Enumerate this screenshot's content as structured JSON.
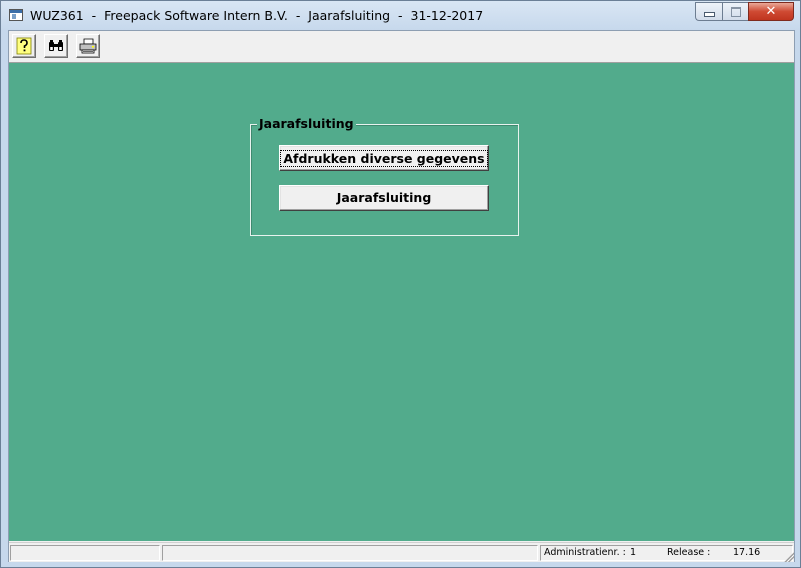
{
  "window": {
    "title": "WUZ361  -  Freepack Software Intern B.V.  -  Jaarafsluiting  -  31-12-2017",
    "icon": "application-window-icon",
    "controls": {
      "minimize_icon": "minimize-icon",
      "maximize_icon": "maximize-icon",
      "close_glyph": "✕"
    }
  },
  "toolbar": {
    "buttons": [
      {
        "name": "help",
        "icon": "question-mark-icon"
      },
      {
        "name": "find",
        "icon": "binoculars-icon"
      },
      {
        "name": "print",
        "icon": "printer-icon"
      }
    ]
  },
  "main": {
    "background_color": "#52ab8c",
    "group": {
      "title": "Jaarafsluiting",
      "buttons": {
        "print_label": "Afdrukken diverse gegevens",
        "close_label": "Jaarafsluiting"
      }
    }
  },
  "statusbar": {
    "panel1": "",
    "panel2": "",
    "admin_label": "Administratienr. :",
    "admin_value": "1",
    "release_label": "Release :",
    "release_value": "17.16"
  }
}
